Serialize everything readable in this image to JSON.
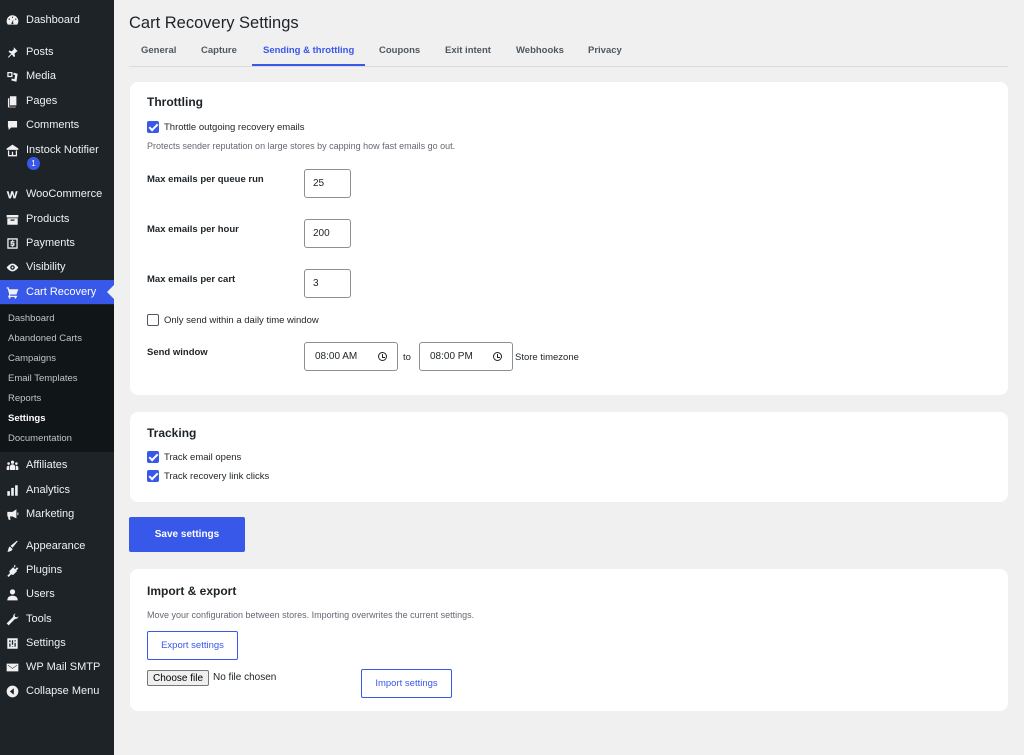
{
  "sidebar": {
    "items": [
      {
        "label": "Dashboard",
        "icon": "dashboard-icon"
      },
      {
        "label": "Posts",
        "icon": "pin-icon"
      },
      {
        "label": "Media",
        "icon": "media-icon"
      },
      {
        "label": "Pages",
        "icon": "pages-icon"
      },
      {
        "label": "Comments",
        "icon": "comment-icon"
      },
      {
        "label": "Instock Notifier",
        "icon": "store-icon"
      },
      {
        "label": "WooCommerce",
        "icon": "woo-icon"
      },
      {
        "label": "Products",
        "icon": "archive-icon"
      },
      {
        "label": "Payments",
        "icon": "dollar-icon"
      },
      {
        "label": "Visibility",
        "icon": "eye-icon"
      },
      {
        "label": "Cart Recovery",
        "icon": "cart-icon"
      },
      {
        "label": "Affiliates",
        "icon": "groups-icon"
      },
      {
        "label": "Analytics",
        "icon": "bar-chart-icon"
      },
      {
        "label": "Marketing",
        "icon": "megaphone-icon"
      },
      {
        "label": "Appearance",
        "icon": "brush-icon"
      },
      {
        "label": "Plugins",
        "icon": "plug-icon"
      },
      {
        "label": "Users",
        "icon": "user-icon"
      },
      {
        "label": "Tools",
        "icon": "wrench-icon"
      },
      {
        "label": "Settings",
        "icon": "settings-icon"
      },
      {
        "label": "WP Mail SMTP",
        "icon": "mail-icon"
      },
      {
        "label": "Collapse Menu",
        "icon": "collapse-icon"
      }
    ],
    "instock_badge": "1",
    "submenu": [
      "Dashboard",
      "Abandoned Carts",
      "Campaigns",
      "Email Templates",
      "Reports",
      "Settings",
      "Documentation"
    ],
    "active_color": "#3858e9"
  },
  "page": {
    "title": "Cart Recovery Settings",
    "tabs": [
      "General",
      "Capture",
      "Sending & throttling",
      "Coupons",
      "Exit intent",
      "Webhooks",
      "Privacy"
    ],
    "active_tab": "Sending & throttling"
  },
  "throttling": {
    "title": "Throttling",
    "throttle_label": "Throttle outgoing recovery emails",
    "throttle_checked": true,
    "help": "Protects sender reputation on large stores by capping how fast emails go out.",
    "per_queue_label": "Max emails per queue run",
    "per_queue_value": "25",
    "per_hour_label": "Max emails per hour",
    "per_hour_value": "200",
    "per_cart_label": "Max emails per cart",
    "per_cart_value": "3",
    "window_only_label": "Only send within a daily time window",
    "window_only_checked": false,
    "send_window_label": "Send window",
    "start_time": "08:00 AM",
    "to_label": "to",
    "end_time": "08:00 PM",
    "timezone_note": "Store timezone"
  },
  "tracking": {
    "title": "Tracking",
    "opens_label": "Track email opens",
    "opens_checked": true,
    "clicks_label": "Track recovery link clicks",
    "clicks_checked": true
  },
  "save_label": "Save settings",
  "import_export": {
    "title": "Import & export",
    "help": "Move your configuration between stores. Importing overwrites the current settings.",
    "export_label": "Export settings",
    "choose_file_label": "Choose file",
    "file_status": "No file chosen",
    "import_label": "Import settings"
  }
}
